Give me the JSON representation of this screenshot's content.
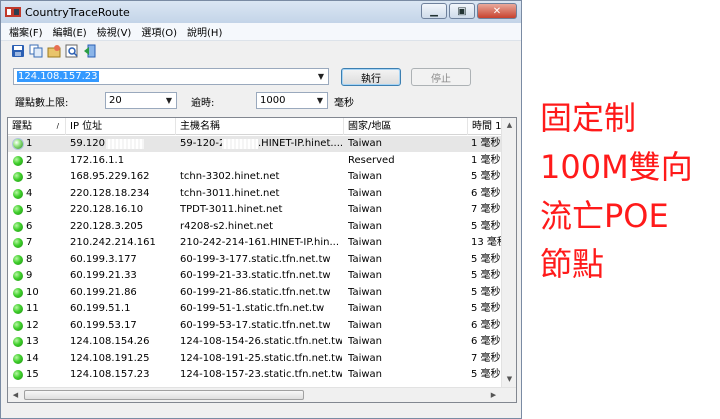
{
  "window": {
    "title": "CountryTraceRoute",
    "buttons": {
      "minimize": "▁",
      "restore": "▣",
      "close": "✕"
    }
  },
  "menu": [
    {
      "label": "檔案(F)"
    },
    {
      "label": "編輯(E)"
    },
    {
      "label": "檢視(V)"
    },
    {
      "label": "選項(O)"
    },
    {
      "label": "說明(H)"
    }
  ],
  "toolbar": {
    "icons": [
      "save-icon",
      "copy-icon",
      "options-icon",
      "find-icon",
      "exit-icon"
    ]
  },
  "target": {
    "value": "124.108.157.23",
    "run_label": "執行",
    "stop_label": "停止"
  },
  "options": {
    "max_hops_label": "躍點數上限:",
    "max_hops_value": "20",
    "timeout_label": "逾時:",
    "timeout_value": "1000",
    "timeout_unit": "毫秒"
  },
  "table": {
    "columns": [
      "躍點",
      "IP 位址",
      "主機名稱",
      "國家/地區",
      "時間 1"
    ],
    "rows": [
      {
        "hop": "1",
        "ip": "59.120.",
        "host": "59-120-2",
        "host_suffix": ".HINET-IP.hinet....",
        "country": "Taiwan",
        "time": "1 毫秒"
      },
      {
        "hop": "2",
        "ip": "172.16.1.1",
        "host": "",
        "host_suffix": "",
        "country": "Reserved",
        "time": "1 毫秒"
      },
      {
        "hop": "3",
        "ip": "168.95.229.162",
        "host": "tchn-3302.hinet.net",
        "host_suffix": "",
        "country": "Taiwan",
        "time": "5 毫秒"
      },
      {
        "hop": "4",
        "ip": "220.128.18.234",
        "host": "tchn-3011.hinet.net",
        "host_suffix": "",
        "country": "Taiwan",
        "time": "6 毫秒"
      },
      {
        "hop": "5",
        "ip": "220.128.16.10",
        "host": "TPDT-3011.hinet.net",
        "host_suffix": "",
        "country": "Taiwan",
        "time": "7 毫秒"
      },
      {
        "hop": "6",
        "ip": "220.128.3.205",
        "host": "r4208-s2.hinet.net",
        "host_suffix": "",
        "country": "Taiwan",
        "time": "5 毫秒"
      },
      {
        "hop": "7",
        "ip": "210.242.214.161",
        "host": "210-242-214-161.HINET-IP.hin...",
        "host_suffix": "",
        "country": "Taiwan",
        "time": "13 毫秒"
      },
      {
        "hop": "8",
        "ip": "60.199.3.177",
        "host": "60-199-3-177.static.tfn.net.tw",
        "host_suffix": "",
        "country": "Taiwan",
        "time": "5 毫秒"
      },
      {
        "hop": "9",
        "ip": "60.199.21.33",
        "host": "60-199-21-33.static.tfn.net.tw",
        "host_suffix": "",
        "country": "Taiwan",
        "time": "5 毫秒"
      },
      {
        "hop": "10",
        "ip": "60.199.21.86",
        "host": "60-199-21-86.static.tfn.net.tw",
        "host_suffix": "",
        "country": "Taiwan",
        "time": "5 毫秒"
      },
      {
        "hop": "11",
        "ip": "60.199.51.1",
        "host": "60-199-51-1.static.tfn.net.tw",
        "host_suffix": "",
        "country": "Taiwan",
        "time": "5 毫秒"
      },
      {
        "hop": "12",
        "ip": "60.199.53.17",
        "host": "60-199-53-17.static.tfn.net.tw",
        "host_suffix": "",
        "country": "Taiwan",
        "time": "6 毫秒"
      },
      {
        "hop": "13",
        "ip": "124.108.154.26",
        "host": "124-108-154-26.static.tfn.net.tw",
        "host_suffix": "",
        "country": "Taiwan",
        "time": "6 毫秒"
      },
      {
        "hop": "14",
        "ip": "124.108.191.25",
        "host": "124-108-191-25.static.tfn.net.tw",
        "host_suffix": "",
        "country": "Taiwan",
        "time": "7 毫秒"
      },
      {
        "hop": "15",
        "ip": "124.108.157.23",
        "host": "124-108-157-23.static.tfn.net.tw",
        "host_suffix": "",
        "country": "Taiwan",
        "time": "5 毫秒"
      }
    ]
  },
  "annotation": [
    "固定制",
    "100M雙向",
    "流亡POE",
    "節點"
  ],
  "colors": {
    "annotation": "#ff1a1a",
    "status_ok": "#3fcf2b",
    "selection": "#3399ff"
  }
}
